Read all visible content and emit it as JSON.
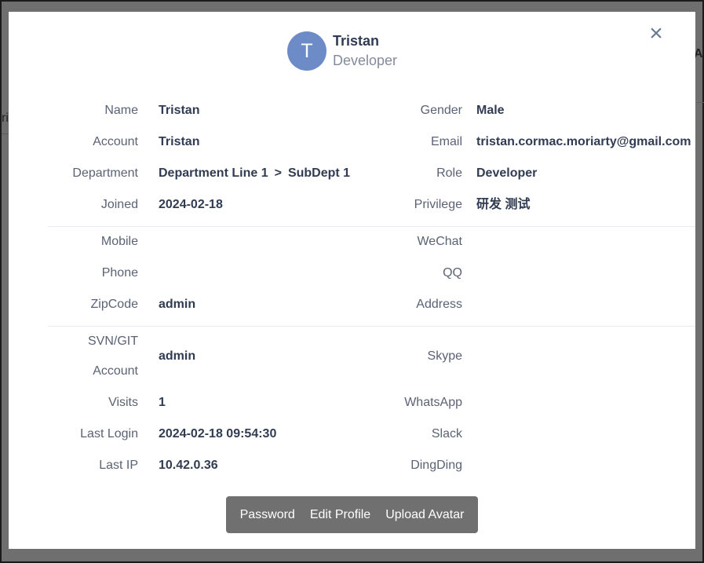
{
  "background": {
    "fragment_left": "ri",
    "fragment_right": "A"
  },
  "profile": {
    "avatar_letter": "T",
    "name": "Tristan",
    "role": "Developer"
  },
  "close_icon": "×",
  "details_basic": [
    {
      "label": "Name",
      "value": "Tristan",
      "label2": "Gender",
      "value2": "Male"
    },
    {
      "label": "Account",
      "value": "Tristan",
      "label2": "Email",
      "value2": "tristan.cormac.moriarty@gmail.com"
    },
    {
      "label": "Department",
      "value": "",
      "label2": "Role",
      "value2": "Developer"
    },
    {
      "label": "Joined",
      "value": "2024-02-18",
      "label2": "Privilege",
      "value2": "研发 测试"
    }
  ],
  "department": {
    "line": "Department Line 1",
    "separator": ">",
    "sub": "SubDept 1"
  },
  "details_contact": [
    {
      "label": "Mobile",
      "value": "",
      "label2": "WeChat",
      "value2": ""
    },
    {
      "label": "Phone",
      "value": "",
      "label2": "QQ",
      "value2": ""
    },
    {
      "label": "ZipCode",
      "value": "admin",
      "label2": "Address",
      "value2": ""
    }
  ],
  "details_accounts": {
    "svn_label_line1": "SVN/GIT",
    "svn_label_line2": "Account",
    "svn_value": "admin",
    "skype_label": "Skype",
    "skype_value": "",
    "rows": [
      {
        "label": "Visits",
        "value": "1",
        "label2": "WhatsApp",
        "value2": ""
      },
      {
        "label": "Last Login",
        "value": "2024-02-18 09:54:30",
        "label2": "Slack",
        "value2": ""
      },
      {
        "label": "Last IP",
        "value": "10.42.0.36",
        "label2": "DingDing",
        "value2": ""
      }
    ]
  },
  "actions": {
    "password": "Password",
    "edit_profile": "Edit Profile",
    "upload_avatar": "Upload Avatar"
  },
  "colors": {
    "avatar_bg": "#6d8cc7",
    "action_bar_bg": "#707070",
    "backdrop": "#6f6f6f"
  }
}
